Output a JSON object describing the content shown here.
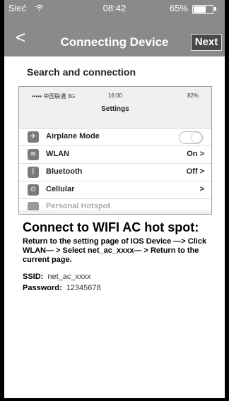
{
  "status_bar": {
    "carrier": "Sieć",
    "time": "08:42",
    "battery_text": "65%",
    "battery_level": 0.65
  },
  "nav": {
    "back_glyph": "<",
    "title": "Connecting Device",
    "next_label": "Next"
  },
  "section_heading": "Search and connection",
  "phone_screenshot": {
    "carrier": "••••• 中国联通 3G",
    "time": "16:00",
    "battery": "82%",
    "title": "Settings",
    "rows": [
      {
        "icon": "airplane-icon",
        "glyph": "✈",
        "label": "Airplane Mode",
        "value": ""
      },
      {
        "icon": "wifi-icon",
        "glyph": "≋",
        "label": "WLAN",
        "value": "On >"
      },
      {
        "icon": "bluetooth-icon",
        "glyph": "ᛒ",
        "label": "Bluetooth",
        "value": "Off >"
      },
      {
        "icon": "cellular-icon",
        "glyph": "⊙",
        "label": "Cellular",
        "value": ">"
      }
    ],
    "partial_row_label": "Personal Hotspot"
  },
  "connect_title": "Connect to WIFI AC hot spot:",
  "instructions": "Return to the setting page of IOS Device —> Click WLAN— > Select net_ac_xxxx— > Return to the current page.",
  "ssid": {
    "label": "SSID:",
    "value": "net_ac_xxxx"
  },
  "password": {
    "label": "Password:",
    "value": "12345678"
  }
}
